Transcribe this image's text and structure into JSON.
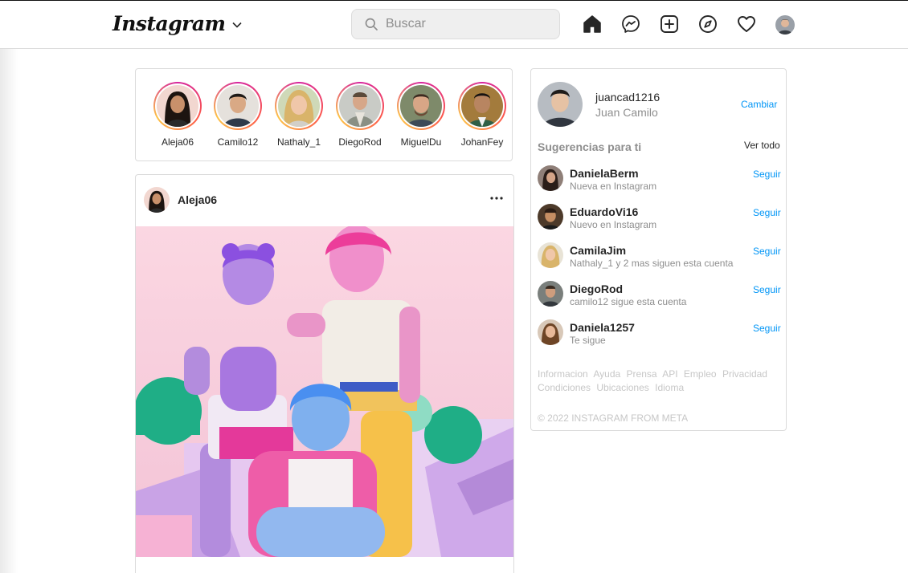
{
  "header": {
    "logo": "Instagram",
    "search_placeholder": "Buscar",
    "icons": [
      "home-icon",
      "messenger-icon",
      "new-post-icon",
      "explore-icon",
      "heart-icon",
      "profile-avatar"
    ]
  },
  "stories": [
    {
      "name": "Aleja06"
    },
    {
      "name": "Camilo12"
    },
    {
      "name": "Nathaly_1"
    },
    {
      "name": "DiegoRod"
    },
    {
      "name": "MiguelDu"
    },
    {
      "name": "JohanFey"
    }
  ],
  "post": {
    "username": "Aleja06",
    "more_icon": "more-icon"
  },
  "profile": {
    "username": "juancad1216",
    "fullname": "Juan Camilo",
    "switch_label": "Cambiar"
  },
  "suggestions": {
    "title": "Sugerencias para ti",
    "see_all": "Ver todo",
    "items": [
      {
        "username": "DanielaBerm",
        "subtitle": "Nueva en Instagram",
        "action": "Seguir"
      },
      {
        "username": "EduardoVi16",
        "subtitle": "Nuevo en Instagram",
        "action": "Seguir"
      },
      {
        "username": "CamilaJim",
        "subtitle": "Nathaly_1 y 2 mas siguen esta cuenta",
        "action": "Seguir"
      },
      {
        "username": "DiegoRod",
        "subtitle": "camilo12 sigue esta cuenta",
        "action": "Seguir"
      },
      {
        "username": "Daniela1257",
        "subtitle": "Te sigue",
        "action": "Seguir"
      }
    ]
  },
  "footer": {
    "links": [
      "Informacion",
      "Ayuda",
      "Prensa",
      "API",
      "Empleo",
      "Privacidad",
      "Condiciones",
      "Ubicaciones",
      "Idioma"
    ],
    "copyright": "© 2022 INSTAGRAM FROM META"
  },
  "colors": {
    "link_blue": "#0095f6",
    "border": "#dbdbdb",
    "muted_text": "#8e8e8e",
    "footer_text": "#c7c7c7",
    "post_background": "#fbd7e2"
  }
}
